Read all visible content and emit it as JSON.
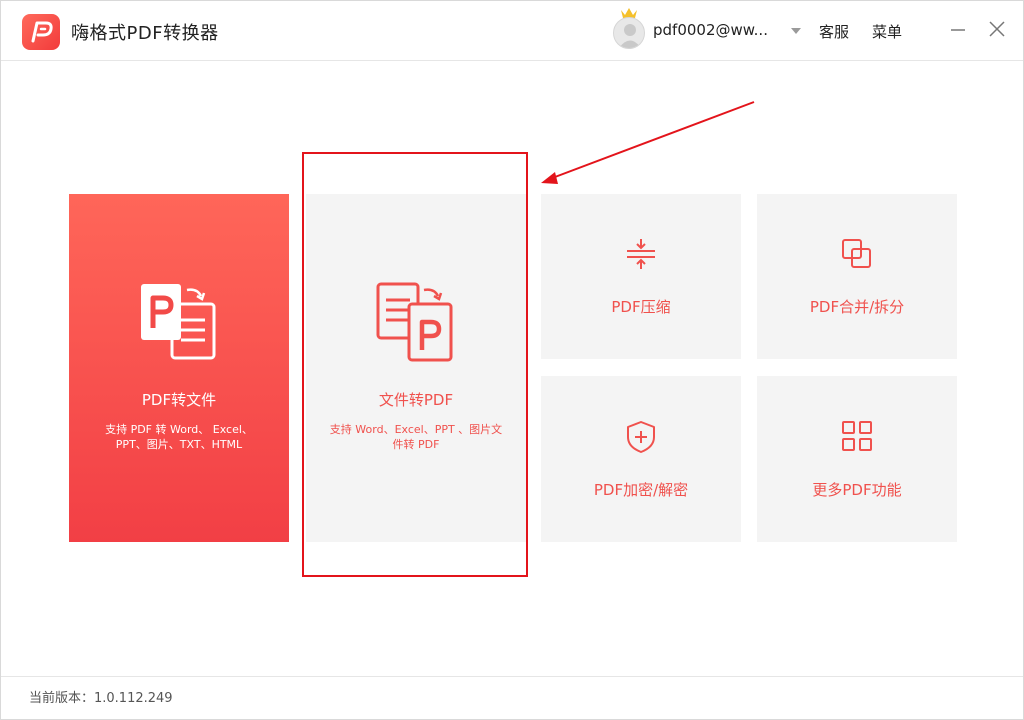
{
  "app": {
    "title": "嗨格式PDF转换器",
    "logo_icon": "pdf-logo-icon",
    "brand_color": "#f23b3b"
  },
  "header": {
    "username": "pdf0002@ww...",
    "service_label": "客服",
    "menu_label": "菜单",
    "icons": [
      "avatar-icon",
      "crown-icon",
      "dropdown-caret-icon",
      "minimize-icon",
      "close-icon"
    ]
  },
  "cards": {
    "pdf_to_file": {
      "label": "PDF转文件",
      "desc_line1": "支持 PDF 转 Word、 Excel、",
      "desc_line2": "PPT、图片、TXT、HTML",
      "icon": "pdf-to-document-icon"
    },
    "file_to_pdf": {
      "label": "文件转PDF",
      "desc_line1": "支持 Word、Excel、PPT 、图片文",
      "desc_line2": "件转 PDF",
      "icon": "document-to-pdf-icon"
    },
    "compress": {
      "label": "PDF压缩",
      "icon": "compress-icon"
    },
    "merge_split": {
      "label": "PDF合并/拆分",
      "icon": "merge-split-icon"
    },
    "encrypt": {
      "label": "PDF加密/解密",
      "icon": "shield-plus-icon"
    },
    "more": {
      "label": "更多PDF功能",
      "icon": "grid-icon"
    }
  },
  "annotation": {
    "highlight_color": "#e3141b"
  },
  "footer": {
    "version_label": "当前版本：1.0.112.249"
  }
}
